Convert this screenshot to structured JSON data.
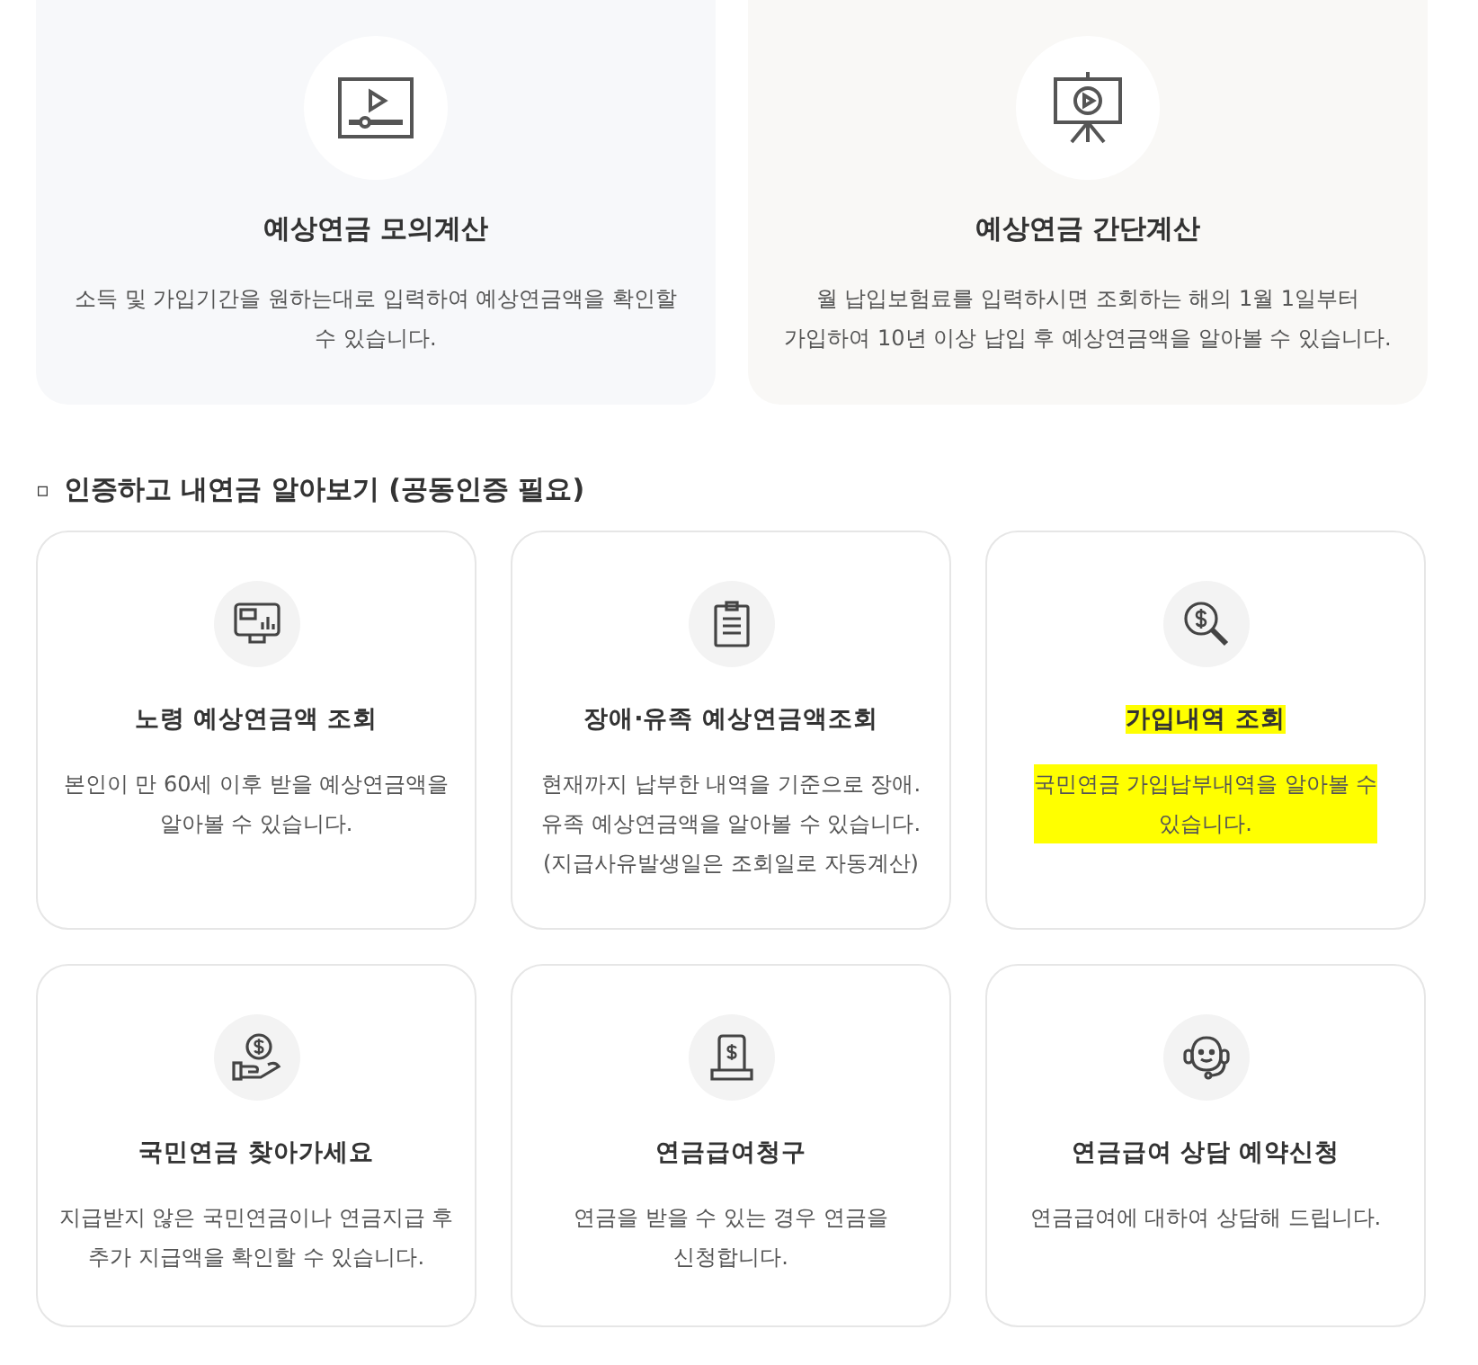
{
  "feature_cards": [
    {
      "title": "예상연금 모의계산",
      "description": "소득 및 가입기간을 원하는대로 입력하여 예상연금액을 확인할\n수 있습니다."
    },
    {
      "title": "예상연금 간단계산",
      "description": "월 납입보험료를 입력하시면 조회하는 해의 1월 1일부터\n가입하여 10년 이상 납입 후 예상연금액을 알아볼 수 있습니다."
    }
  ],
  "section": {
    "bullet": "▫",
    "title": "인증하고 내연금 알아보기 (공동인증 필요)"
  },
  "service_cards": [
    {
      "title": "노령 예상연금액 조회",
      "description": "본인이 만 60세 이후 받을 예상연금액을\n알아볼 수 있습니다.",
      "highlighted": false
    },
    {
      "title": "장애·유족 예상연금액조회",
      "description": "현재까지 납부한 내역을 기준으로 장애.\n유족 예상연금액을 알아볼 수 있습니다.\n(지급사유발생일은 조회일로 자동계산)",
      "highlighted": false
    },
    {
      "title": "가입내역 조회",
      "description": "국민연금 가입납부내역을 알아볼 수\n있습니다.",
      "highlighted": true
    },
    {
      "title": "국민연금 찾아가세요",
      "description": "지급받지 않은 국민연금이나 연금지급 후\n추가 지급액을 확인할 수 있습니다.",
      "highlighted": false
    },
    {
      "title": "연금급여청구",
      "description": "연금을 받을 수 있는 경우 연금을\n신청합니다.",
      "highlighted": false
    },
    {
      "title": "연금급여 상담 예약신청",
      "description": "연금급여에 대하여 상담해 드립니다.",
      "highlighted": false
    }
  ]
}
